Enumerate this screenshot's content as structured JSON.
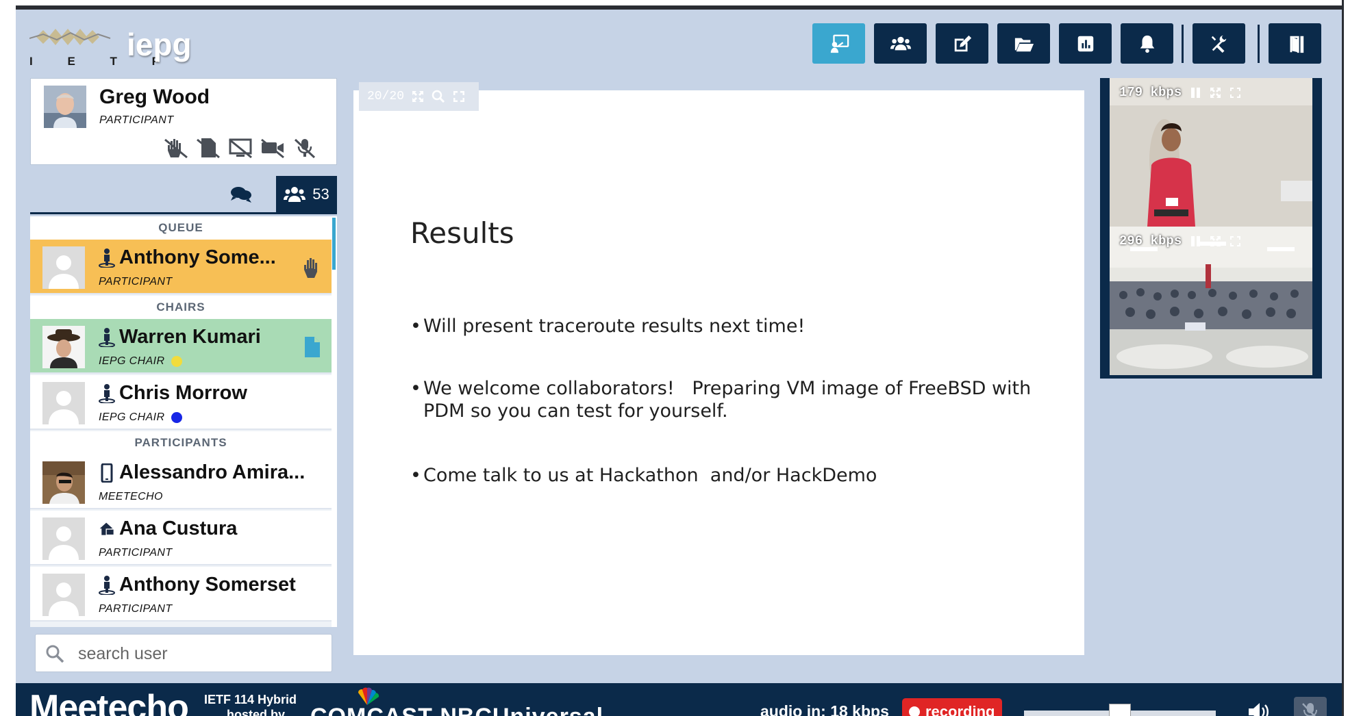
{
  "header": {
    "logo_text": "I E T F",
    "wg_name": "iepg",
    "toolbar": [
      {
        "id": "presentation",
        "icon": "presentation-icon",
        "active": true
      },
      {
        "id": "participants",
        "icon": "users-icon",
        "active": false
      },
      {
        "id": "notes",
        "icon": "edit-icon",
        "active": false
      },
      {
        "id": "files",
        "icon": "folder-open-icon",
        "active": false
      },
      {
        "id": "polls",
        "icon": "chart-icon",
        "active": false
      },
      {
        "id": "notifications",
        "icon": "bell-icon",
        "active": false
      },
      {
        "id": "settings",
        "icon": "tools-icon",
        "active": false
      },
      {
        "id": "leave",
        "icon": "exit-icon",
        "active": false
      }
    ]
  },
  "user": {
    "name": "Greg Wood",
    "role": "PARTICIPANT"
  },
  "tabs": {
    "participants_count": "53"
  },
  "queue_header": "QUEUE",
  "chairs_header": "CHAIRS",
  "participants_header": "PARTICIPANTS",
  "queue": [
    {
      "name": "Anthony Some...",
      "role": "PARTICIPANT"
    }
  ],
  "chairs": [
    {
      "name": "Warren Kumari",
      "role": "IEPG CHAIR",
      "dot_color": "#f2dc3c"
    },
    {
      "name": "Chris Morrow",
      "role": "IEPG CHAIR",
      "dot_color": "#1726e6"
    }
  ],
  "participants": [
    {
      "name": "Alessandro Amira...",
      "role": "MEETECHO"
    },
    {
      "name": "Ana Custura",
      "role": "PARTICIPANT"
    },
    {
      "name": "Anthony Somerset",
      "role": "PARTICIPANT"
    }
  ],
  "search": {
    "placeholder": "search user"
  },
  "slide": {
    "counter": "20/20",
    "title": "Results",
    "bullets": [
      "Will present traceroute results next time!",
      "We welcome collaborators!   Preparing VM image of FreeBSD with\nPDM so you can test for yourself.",
      "Come talk to us at Hackathon  and/or HackDemo"
    ]
  },
  "videos": [
    {
      "rate": "179 kbps"
    },
    {
      "rate": "296 kbps"
    }
  ],
  "footer": {
    "brand": "Meetecho",
    "event_line1": "IETF 114 Hybrid",
    "event_line2": "hosted by",
    "sponsor": "COMCAST NBCUniversal",
    "audio_in": "audio in: 18 kbps",
    "recording": "recording",
    "volume_level": 0.5
  },
  "colors": {
    "background": "#c6d3e6",
    "navy": "#0b2a4a",
    "accent": "#3aa7cf",
    "queue": "#f7bf55",
    "chair_active": "#a9dbb5",
    "recording": "#e02525"
  }
}
